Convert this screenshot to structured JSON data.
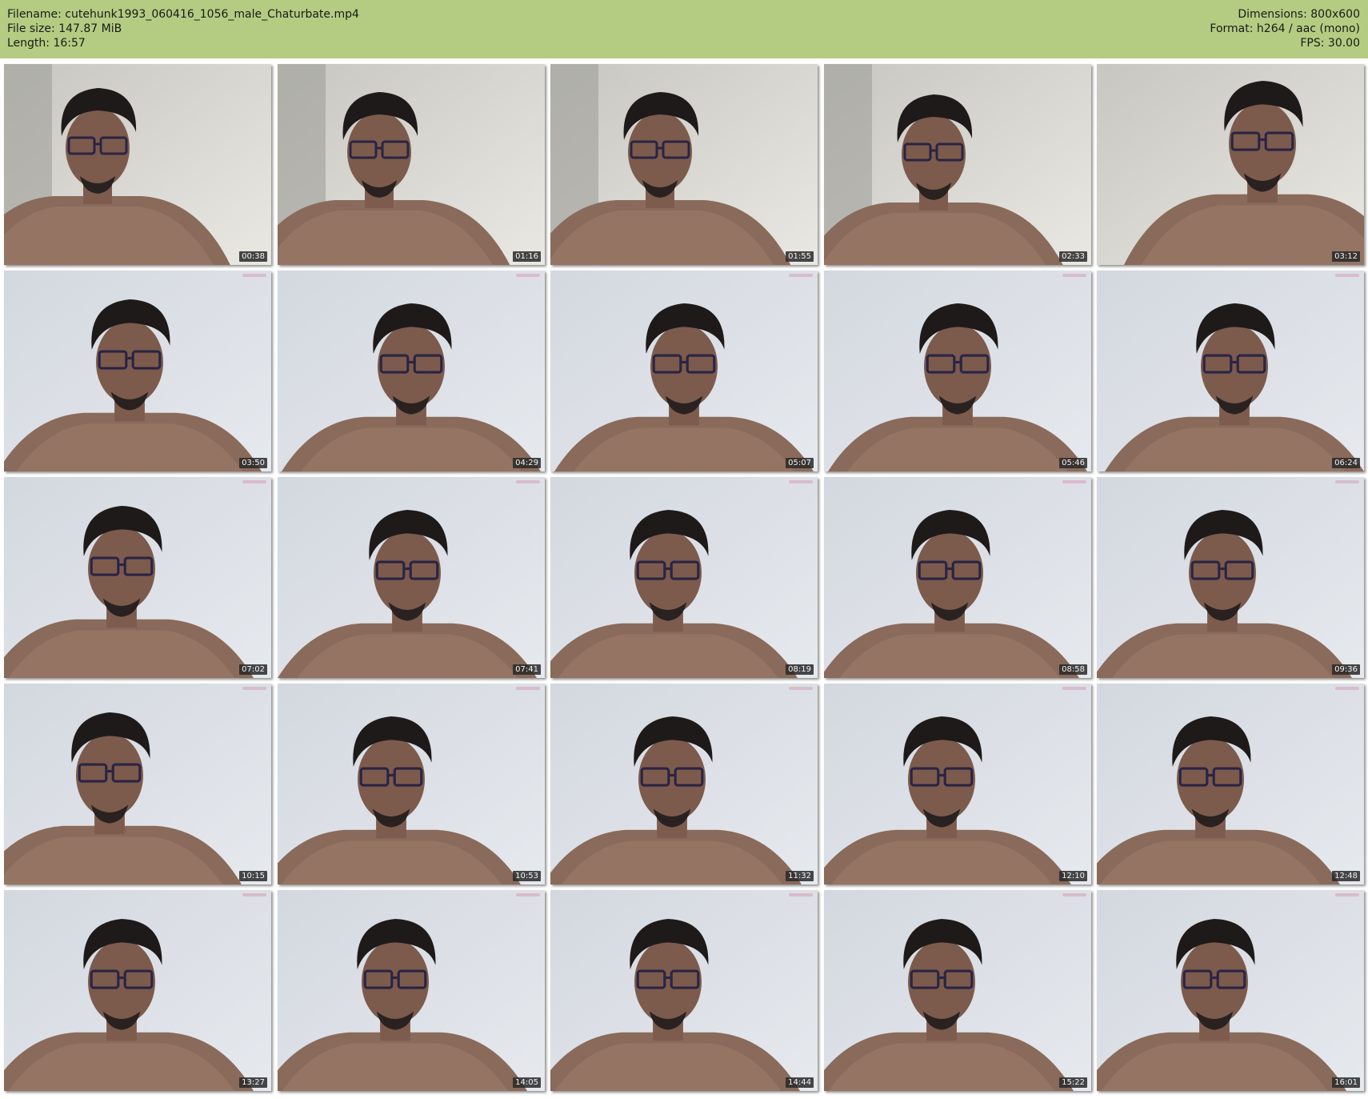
{
  "header": {
    "filename": "Filename: cutehunk1993_060416_1056_male_Chaturbate.mp4",
    "filesize": "File size: 147.87 MiB",
    "length": "Length: 16:57",
    "dimensions": "Dimensions: 800x600",
    "format": "Format: h264 / aac (mono)",
    "fps": "FPS: 30.00"
  },
  "colors": {
    "header_bg": "#b3cc82",
    "page_bg": "#ffffff"
  },
  "thumbnails": [
    {
      "timestamp": "00:38"
    },
    {
      "timestamp": "01:16"
    },
    {
      "timestamp": "01:55"
    },
    {
      "timestamp": "02:33"
    },
    {
      "timestamp": "03:12"
    },
    {
      "timestamp": "03:50"
    },
    {
      "timestamp": "04:29"
    },
    {
      "timestamp": "05:07"
    },
    {
      "timestamp": "05:46"
    },
    {
      "timestamp": "06:24"
    },
    {
      "timestamp": "07:02"
    },
    {
      "timestamp": "07:41"
    },
    {
      "timestamp": "08:19"
    },
    {
      "timestamp": "08:58"
    },
    {
      "timestamp": "09:36"
    },
    {
      "timestamp": "10:15"
    },
    {
      "timestamp": "10:53"
    },
    {
      "timestamp": "11:32"
    },
    {
      "timestamp": "12:10"
    },
    {
      "timestamp": "12:48"
    },
    {
      "timestamp": "13:27"
    },
    {
      "timestamp": "14:05"
    },
    {
      "timestamp": "14:44"
    },
    {
      "timestamp": "15:22"
    },
    {
      "timestamp": "16:01"
    }
  ]
}
